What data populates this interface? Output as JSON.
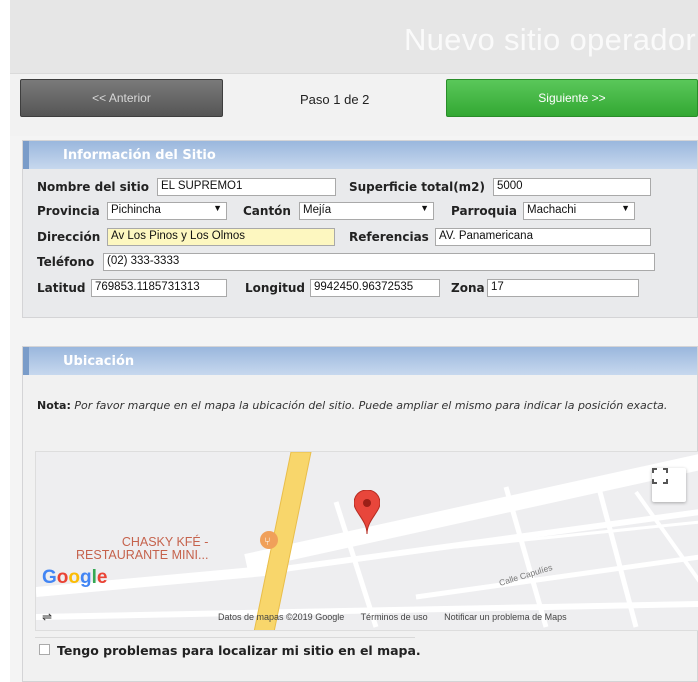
{
  "header": {
    "title": "Nuevo sitio operador"
  },
  "nav": {
    "prev_label": "<< Anterior",
    "step_text": "Paso 1 de 2",
    "next_label": "Siguiente >>"
  },
  "info": {
    "heading": "Información del Sitio",
    "nombre_label": "Nombre del sitio",
    "nombre_value": "EL SUPREMO1",
    "superficie_label": "Superficie total(m2)",
    "superficie_value": "5000",
    "provincia_label": "Provincia",
    "provincia_value": "Pichincha",
    "canton_label": "Cantón",
    "canton_value": "Mejía",
    "parroquia_label": "Parroquia",
    "parroquia_value": "Machachi",
    "direccion_label": "Dirección",
    "direccion_value": "Av Los Pinos y Los Olmos",
    "referencias_label": "Referencias",
    "referencias_value": "AV. Panamericana",
    "telefono_label": "Teléfono",
    "telefono_value": "(02) 333-3333",
    "latitud_label": "Latitud",
    "latitud_value": "769853.1185731313",
    "longitud_label": "Longitud",
    "longitud_value": "9942450.96372535",
    "zona_label": "Zona",
    "zona_value": "17"
  },
  "ubicacion": {
    "heading": "Ubicación",
    "nota_label": "Nota:",
    "nota_text": "Por favor marque en el mapa la ubicación del sitio. Puede ampliar el mismo para indicar la posición exacta.",
    "checkbox_label": "Tengo problemas para localizar mi sitio en el mapa."
  },
  "map": {
    "poi_line1": "CHASKY KFÉ -",
    "poi_line2": "RESTAURANTE MINI...",
    "street": "Calle Capulíes",
    "logo": "Google",
    "attrib_data": "Datos de mapas ©2019 Google",
    "attrib_terms": "Términos de uso",
    "attrib_report": "Notificar un problema de Maps",
    "pin_icon": "map-pin-icon",
    "fullscreen_icon": "fullscreen-icon",
    "colors": {
      "road_yellow": "#f8d66b",
      "pin_red": "#e8463b",
      "next_green": "#3cb43c"
    }
  }
}
